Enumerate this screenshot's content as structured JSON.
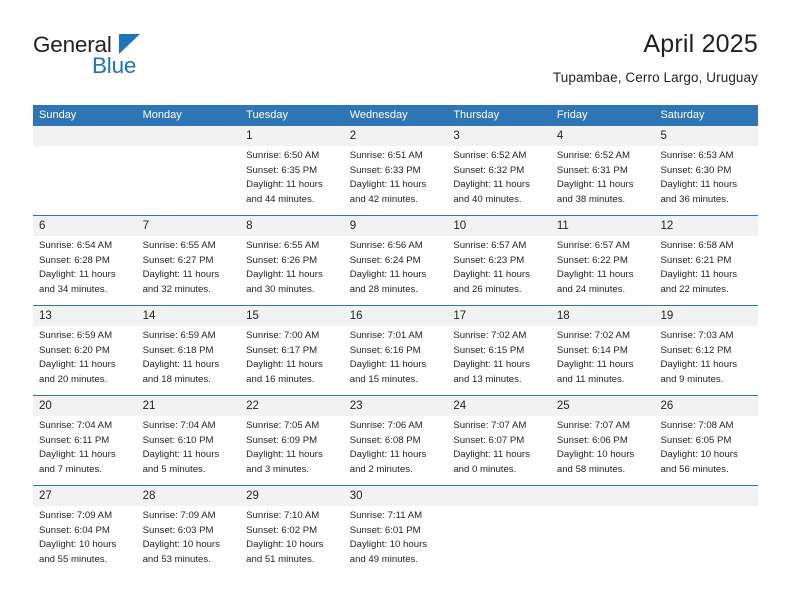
{
  "brand": {
    "name_top": "General",
    "name_bottom": "Blue",
    "accent_color": "#1b75bb"
  },
  "header": {
    "title": "April 2025",
    "subtitle": "Tupambae, Cerro Largo, Uruguay"
  },
  "calendar": {
    "header_color": "#2e75b6",
    "number_band_color": "#f2f2f2",
    "day_names": [
      "Sunday",
      "Monday",
      "Tuesday",
      "Wednesday",
      "Thursday",
      "Friday",
      "Saturday"
    ],
    "weeks": [
      [
        {
          "day": "",
          "lines": []
        },
        {
          "day": "",
          "lines": []
        },
        {
          "day": "1",
          "lines": [
            "Sunrise: 6:50 AM",
            "Sunset: 6:35 PM",
            "Daylight: 11 hours",
            "and 44 minutes."
          ]
        },
        {
          "day": "2",
          "lines": [
            "Sunrise: 6:51 AM",
            "Sunset: 6:33 PM",
            "Daylight: 11 hours",
            "and 42 minutes."
          ]
        },
        {
          "day": "3",
          "lines": [
            "Sunrise: 6:52 AM",
            "Sunset: 6:32 PM",
            "Daylight: 11 hours",
            "and 40 minutes."
          ]
        },
        {
          "day": "4",
          "lines": [
            "Sunrise: 6:52 AM",
            "Sunset: 6:31 PM",
            "Daylight: 11 hours",
            "and 38 minutes."
          ]
        },
        {
          "day": "5",
          "lines": [
            "Sunrise: 6:53 AM",
            "Sunset: 6:30 PM",
            "Daylight: 11 hours",
            "and 36 minutes."
          ]
        }
      ],
      [
        {
          "day": "6",
          "lines": [
            "Sunrise: 6:54 AM",
            "Sunset: 6:28 PM",
            "Daylight: 11 hours",
            "and 34 minutes."
          ]
        },
        {
          "day": "7",
          "lines": [
            "Sunrise: 6:55 AM",
            "Sunset: 6:27 PM",
            "Daylight: 11 hours",
            "and 32 minutes."
          ]
        },
        {
          "day": "8",
          "lines": [
            "Sunrise: 6:55 AM",
            "Sunset: 6:26 PM",
            "Daylight: 11 hours",
            "and 30 minutes."
          ]
        },
        {
          "day": "9",
          "lines": [
            "Sunrise: 6:56 AM",
            "Sunset: 6:24 PM",
            "Daylight: 11 hours",
            "and 28 minutes."
          ]
        },
        {
          "day": "10",
          "lines": [
            "Sunrise: 6:57 AM",
            "Sunset: 6:23 PM",
            "Daylight: 11 hours",
            "and 26 minutes."
          ]
        },
        {
          "day": "11",
          "lines": [
            "Sunrise: 6:57 AM",
            "Sunset: 6:22 PM",
            "Daylight: 11 hours",
            "and 24 minutes."
          ]
        },
        {
          "day": "12",
          "lines": [
            "Sunrise: 6:58 AM",
            "Sunset: 6:21 PM",
            "Daylight: 11 hours",
            "and 22 minutes."
          ]
        }
      ],
      [
        {
          "day": "13",
          "lines": [
            "Sunrise: 6:59 AM",
            "Sunset: 6:20 PM",
            "Daylight: 11 hours",
            "and 20 minutes."
          ]
        },
        {
          "day": "14",
          "lines": [
            "Sunrise: 6:59 AM",
            "Sunset: 6:18 PM",
            "Daylight: 11 hours",
            "and 18 minutes."
          ]
        },
        {
          "day": "15",
          "lines": [
            "Sunrise: 7:00 AM",
            "Sunset: 6:17 PM",
            "Daylight: 11 hours",
            "and 16 minutes."
          ]
        },
        {
          "day": "16",
          "lines": [
            "Sunrise: 7:01 AM",
            "Sunset: 6:16 PM",
            "Daylight: 11 hours",
            "and 15 minutes."
          ]
        },
        {
          "day": "17",
          "lines": [
            "Sunrise: 7:02 AM",
            "Sunset: 6:15 PM",
            "Daylight: 11 hours",
            "and 13 minutes."
          ]
        },
        {
          "day": "18",
          "lines": [
            "Sunrise: 7:02 AM",
            "Sunset: 6:14 PM",
            "Daylight: 11 hours",
            "and 11 minutes."
          ]
        },
        {
          "day": "19",
          "lines": [
            "Sunrise: 7:03 AM",
            "Sunset: 6:12 PM",
            "Daylight: 11 hours",
            "and 9 minutes."
          ]
        }
      ],
      [
        {
          "day": "20",
          "lines": [
            "Sunrise: 7:04 AM",
            "Sunset: 6:11 PM",
            "Daylight: 11 hours",
            "and 7 minutes."
          ]
        },
        {
          "day": "21",
          "lines": [
            "Sunrise: 7:04 AM",
            "Sunset: 6:10 PM",
            "Daylight: 11 hours",
            "and 5 minutes."
          ]
        },
        {
          "day": "22",
          "lines": [
            "Sunrise: 7:05 AM",
            "Sunset: 6:09 PM",
            "Daylight: 11 hours",
            "and 3 minutes."
          ]
        },
        {
          "day": "23",
          "lines": [
            "Sunrise: 7:06 AM",
            "Sunset: 6:08 PM",
            "Daylight: 11 hours",
            "and 2 minutes."
          ]
        },
        {
          "day": "24",
          "lines": [
            "Sunrise: 7:07 AM",
            "Sunset: 6:07 PM",
            "Daylight: 11 hours",
            "and 0 minutes."
          ]
        },
        {
          "day": "25",
          "lines": [
            "Sunrise: 7:07 AM",
            "Sunset: 6:06 PM",
            "Daylight: 10 hours",
            "and 58 minutes."
          ]
        },
        {
          "day": "26",
          "lines": [
            "Sunrise: 7:08 AM",
            "Sunset: 6:05 PM",
            "Daylight: 10 hours",
            "and 56 minutes."
          ]
        }
      ],
      [
        {
          "day": "27",
          "lines": [
            "Sunrise: 7:09 AM",
            "Sunset: 6:04 PM",
            "Daylight: 10 hours",
            "and 55 minutes."
          ]
        },
        {
          "day": "28",
          "lines": [
            "Sunrise: 7:09 AM",
            "Sunset: 6:03 PM",
            "Daylight: 10 hours",
            "and 53 minutes."
          ]
        },
        {
          "day": "29",
          "lines": [
            "Sunrise: 7:10 AM",
            "Sunset: 6:02 PM",
            "Daylight: 10 hours",
            "and 51 minutes."
          ]
        },
        {
          "day": "30",
          "lines": [
            "Sunrise: 7:11 AM",
            "Sunset: 6:01 PM",
            "Daylight: 10 hours",
            "and 49 minutes."
          ]
        },
        {
          "day": "",
          "lines": []
        },
        {
          "day": "",
          "lines": []
        },
        {
          "day": "",
          "lines": []
        }
      ]
    ]
  }
}
